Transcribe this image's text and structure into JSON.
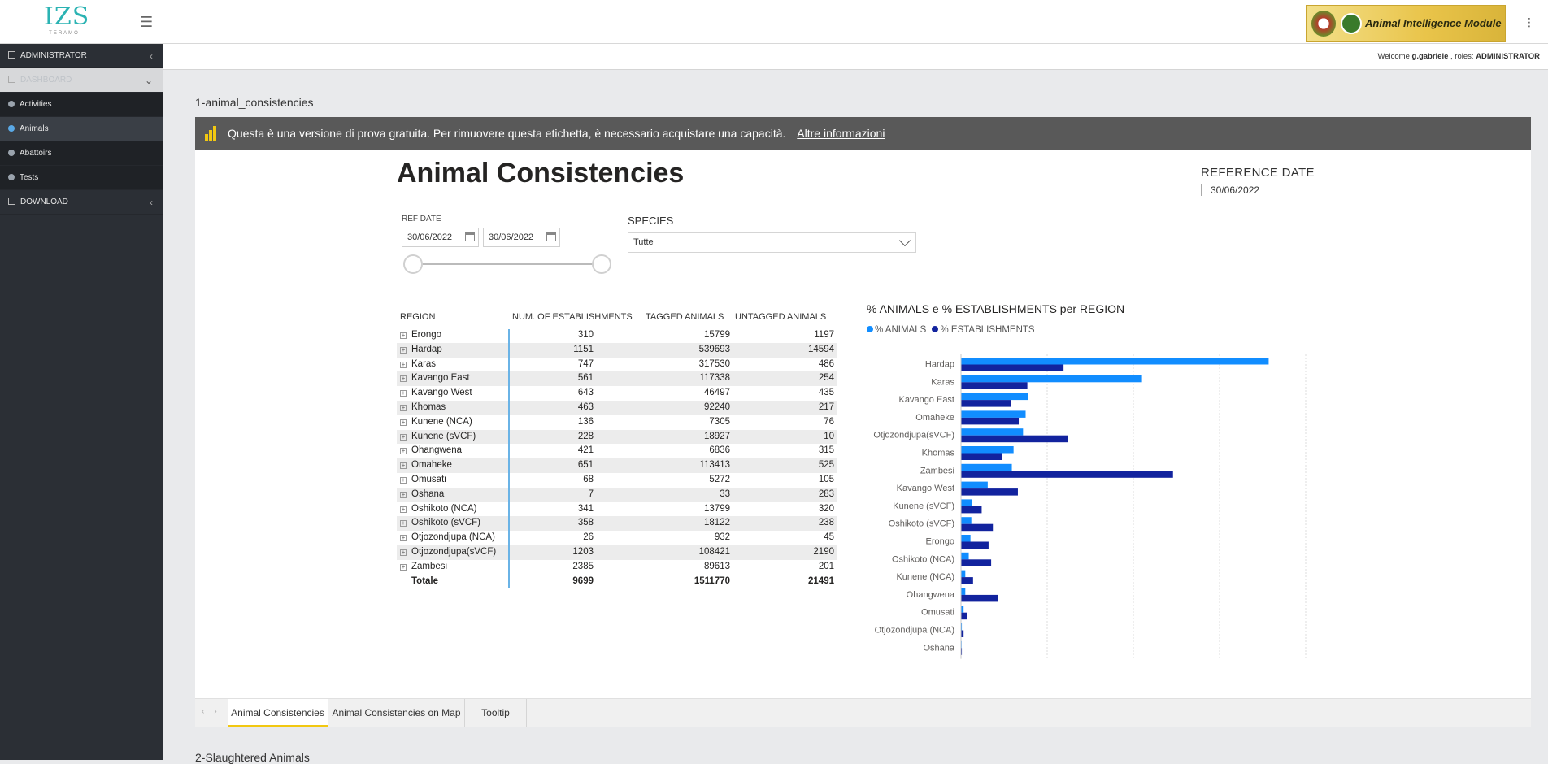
{
  "app": {
    "logo_text": "IZS",
    "logo_sub": "TERAMO",
    "banner_text": "Animal Intelligence Module"
  },
  "sidebar": {
    "items": [
      {
        "label": "ADMINISTRATOR",
        "type": "head"
      },
      {
        "label": "DASHBOARD",
        "type": "active"
      },
      {
        "label": "Activities",
        "type": "sub"
      },
      {
        "label": "Animals",
        "type": "sel"
      },
      {
        "label": "Abattoirs",
        "type": "sub"
      },
      {
        "label": "Tests",
        "type": "sub"
      },
      {
        "label": "DOWNLOAD",
        "type": "head"
      }
    ]
  },
  "header": {
    "welcome_prefix": "Welcome",
    "user": "g.gabriele",
    "roles_prefix": ", roles:",
    "role": "ADMINISTRATOR"
  },
  "section": {
    "title": "1-animal_consistencies",
    "next_title": "2-Slaughtered Animals"
  },
  "trial": {
    "message": "Questa è una versione di prova gratuita. Per rimuovere questa etichetta, è necessario acquistare una capacità.",
    "link": "Altre informazioni"
  },
  "report": {
    "title": "Animal Consistencies",
    "reference_date_label": "REFERENCE DATE",
    "reference_date_value": "30/06/2022",
    "ref_date_label": "REF DATE",
    "date_from": "30/06/2022",
    "date_to": "30/06/2022",
    "species_label": "SPECIES",
    "species_value": "Tutte"
  },
  "table": {
    "headers": [
      "REGION",
      "NUM. OF ESTABLISHMENTS",
      "TAGGED ANIMALS",
      "UNTAGGED ANIMALS"
    ],
    "rows": [
      [
        "Erongo",
        "310",
        "15799",
        "1197"
      ],
      [
        "Hardap",
        "1151",
        "539693",
        "14594"
      ],
      [
        "Karas",
        "747",
        "317530",
        "486"
      ],
      [
        "Kavango East",
        "561",
        "117338",
        "254"
      ],
      [
        "Kavango West",
        "643",
        "46497",
        "435"
      ],
      [
        "Khomas",
        "463",
        "92240",
        "217"
      ],
      [
        "Kunene (NCA)",
        "136",
        "7305",
        "76"
      ],
      [
        "Kunene (sVCF)",
        "228",
        "18927",
        "10"
      ],
      [
        "Ohangwena",
        "421",
        "6836",
        "315"
      ],
      [
        "Omaheke",
        "651",
        "113413",
        "525"
      ],
      [
        "Omusati",
        "68",
        "5272",
        "105"
      ],
      [
        "Oshana",
        "7",
        "33",
        "283"
      ],
      [
        "Oshikoto (NCA)",
        "341",
        "13799",
        "320"
      ],
      [
        "Oshikoto (sVCF)",
        "358",
        "18122",
        "238"
      ],
      [
        "Otjozondjupa (NCA)",
        "26",
        "932",
        "45"
      ],
      [
        "Otjozondjupa(sVCF)",
        "1203",
        "108421",
        "2190"
      ],
      [
        "Zambesi",
        "2385",
        "89613",
        "201"
      ]
    ],
    "total": [
      "Totale",
      "9699",
      "1511770",
      "21491"
    ]
  },
  "chart_data": {
    "type": "bar",
    "orientation": "horizontal",
    "title": "% ANIMALS e % ESTABLISHMENTS per REGION",
    "categories": [
      "Hardap",
      "Karas",
      "Kavango East",
      "Omaheke",
      "Otjozondjupa(sVCF)",
      "Khomas",
      "Zambesi",
      "Kavango West",
      "Kunene (sVCF)",
      "Oshikoto (sVCF)",
      "Erongo",
      "Oshikoto (NCA)",
      "Kunene (NCA)",
      "Ohangwena",
      "Omusati",
      "Otjozondjupa (NCA)",
      "Oshana"
    ],
    "series": [
      {
        "name": "% ANIMALS",
        "color": "#118dff",
        "values": [
          35.7,
          21.0,
          7.8,
          7.5,
          7.2,
          6.1,
          5.9,
          3.1,
          1.3,
          1.2,
          1.1,
          0.9,
          0.5,
          0.5,
          0.3,
          0.1,
          0.0
        ]
      },
      {
        "name": "% ESTABLISHMENTS",
        "color": "#12239e",
        "values": [
          11.9,
          7.7,
          5.8,
          6.7,
          12.4,
          4.8,
          24.6,
          6.6,
          2.4,
          3.7,
          3.2,
          3.5,
          1.4,
          4.3,
          0.7,
          0.3,
          0.1
        ]
      }
    ],
    "xticks": [
      "0%",
      "10%",
      "20%",
      "30%",
      "40%"
    ],
    "xlim": [
      0,
      40
    ],
    "legend_position": "top-left",
    "grid": true
  },
  "tabs": {
    "items": [
      "Animal Consistencies",
      "Animal Consistencies on Map",
      "Tooltip"
    ],
    "active": 0
  }
}
